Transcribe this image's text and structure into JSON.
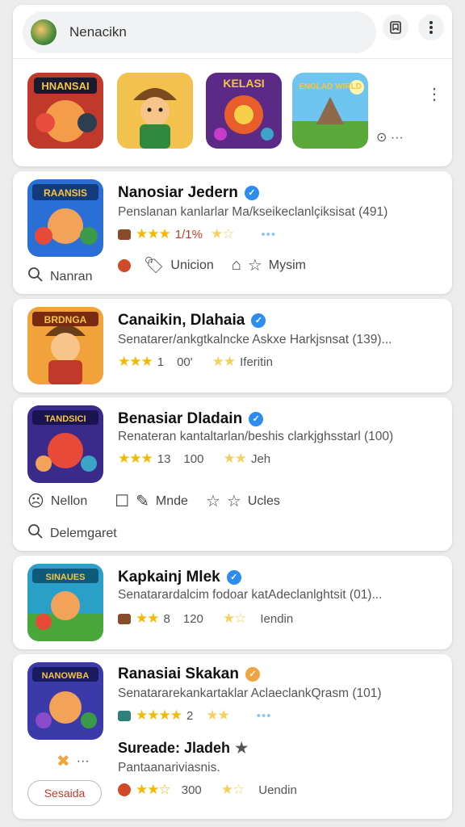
{
  "header": {
    "search_text": "Nenacikn",
    "bookmark_icon": "bookmark-icon",
    "more_icon": "more-vert-icon",
    "featured": [
      {
        "label": "HNANSAI"
      },
      {
        "label": ""
      },
      {
        "label": "KELASI"
      },
      {
        "label": "ENGLAD WIRLD"
      }
    ],
    "featured_more": "⋮",
    "featured_ctrl": "⊙ ···"
  },
  "apps": [
    {
      "title": "Nanosiar Jedern",
      "icon_text": "RAANSIS",
      "description": "Penslanan kanlarlar Ma/kseikeclanlçiksisat (491)",
      "rating_left": "1/1%",
      "action_search": "Nanran",
      "action_2": "Unicion",
      "action_3": "Mysim"
    },
    {
      "title": "Canaikin, Dlahaia",
      "icon_text": "BRDNGA",
      "description": "Senatarer/ankgtkalncke Askxe Harkjsnsat (139)...",
      "rating_left": "1",
      "rating_mid": "00'",
      "rating_right": "Iferitin"
    },
    {
      "title": "Benasiar Dladain",
      "icon_text": "TANDSICI",
      "description": "Renateran kantaltarlan/beshis clarkjghsstarl (100)",
      "rating_left": "13",
      "rating_mid": "100",
      "rating_right": "Jeh",
      "action_1": "Nellon",
      "action_2": "Mnde",
      "action_3": "Ucles",
      "action_search": "Delemgaret"
    },
    {
      "title": "Kapkainj Mlek",
      "icon_text": "SINAUES",
      "description": "Senatarardalcim fodoar katAdeclanlghtsit (01)...",
      "rating_left": "8",
      "rating_mid": "120",
      "rating_right": "Iendin"
    },
    {
      "title": "Ranasiai Skakan",
      "icon_text": "NANOWBA",
      "description": "Senatararekankartaklar AclaeclankQrasm (101)",
      "rating_left": "2",
      "sub_title": "Sureade: Jladeh",
      "sub_desc": "Pantaanariviasnis.",
      "sub_rating_mid": "300",
      "sub_rating_right": "Uendin",
      "button_label": "Sesaida",
      "ctrl_more": "···"
    }
  ],
  "colors": {
    "background": "#ececec",
    "verified_blue": "#2d8cf0",
    "star_yellow": "#f5b800",
    "accent_red": "#c0392b"
  }
}
